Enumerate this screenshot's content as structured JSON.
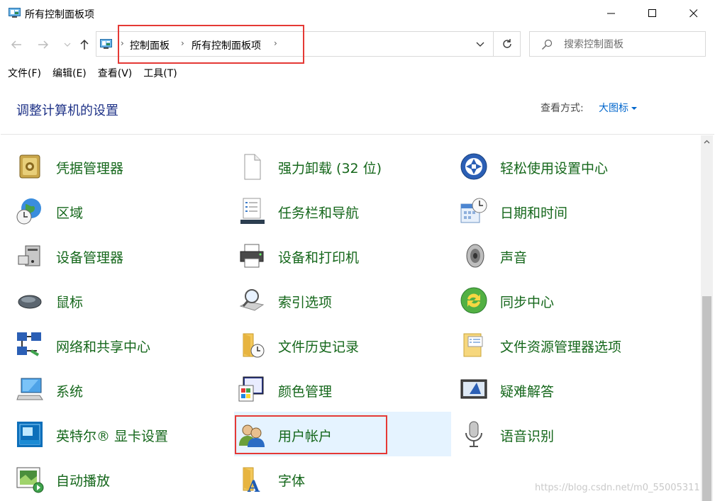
{
  "window": {
    "title": "所有控制面板项"
  },
  "nav": {
    "breadcrumb": [
      "控制面板",
      "所有控制面板项"
    ],
    "search_placeholder": "搜索控制面板"
  },
  "menu": [
    "文件(F)",
    "编辑(E)",
    "查看(V)",
    "工具(T)"
  ],
  "header": {
    "title": "调整计算机的设置",
    "view_by_label": "查看方式:",
    "view_by_value": "大图标"
  },
  "items": [
    {
      "label": "凭据管理器",
      "icon": "credential-manager-icon"
    },
    {
      "label": "强力卸载 (32 位)",
      "icon": "blank-document-icon"
    },
    {
      "label": "轻松使用设置中心",
      "icon": "ease-of-access-icon"
    },
    {
      "label": "区域",
      "icon": "globe-clock-icon"
    },
    {
      "label": "任务栏和导航",
      "icon": "taskbar-icon"
    },
    {
      "label": "日期和时间",
      "icon": "calendar-clock-icon"
    },
    {
      "label": "设备管理器",
      "icon": "device-manager-icon"
    },
    {
      "label": "设备和打印机",
      "icon": "printer-icon"
    },
    {
      "label": "声音",
      "icon": "speaker-icon"
    },
    {
      "label": "鼠标",
      "icon": "mouse-icon"
    },
    {
      "label": "索引选项",
      "icon": "indexing-magnifier-icon"
    },
    {
      "label": "同步中心",
      "icon": "sync-icon"
    },
    {
      "label": "网络和共享中心",
      "icon": "network-icon"
    },
    {
      "label": "文件历史记录",
      "icon": "file-history-icon"
    },
    {
      "label": "文件资源管理器选项",
      "icon": "folder-options-icon"
    },
    {
      "label": "系统",
      "icon": "computer-icon"
    },
    {
      "label": "颜色管理",
      "icon": "color-management-icon"
    },
    {
      "label": "疑难解答",
      "icon": "troubleshooting-icon"
    },
    {
      "label": "英特尔® 显卡设置",
      "icon": "intel-graphics-icon"
    },
    {
      "label": "用户帐户",
      "icon": "user-accounts-icon",
      "selected": true
    },
    {
      "label": "语音识别",
      "icon": "microphone-icon"
    },
    {
      "label": "自动播放",
      "icon": "autoplay-icon"
    },
    {
      "label": "字体",
      "icon": "fonts-icon"
    }
  ],
  "watermark": "https://blog.csdn.net/m0_55005311",
  "colors": {
    "item_text": "#15671b",
    "title_text": "#1e3287",
    "link": "#0066cc",
    "highlight": "#e53935",
    "selected_bg": "#e5f3ff"
  }
}
